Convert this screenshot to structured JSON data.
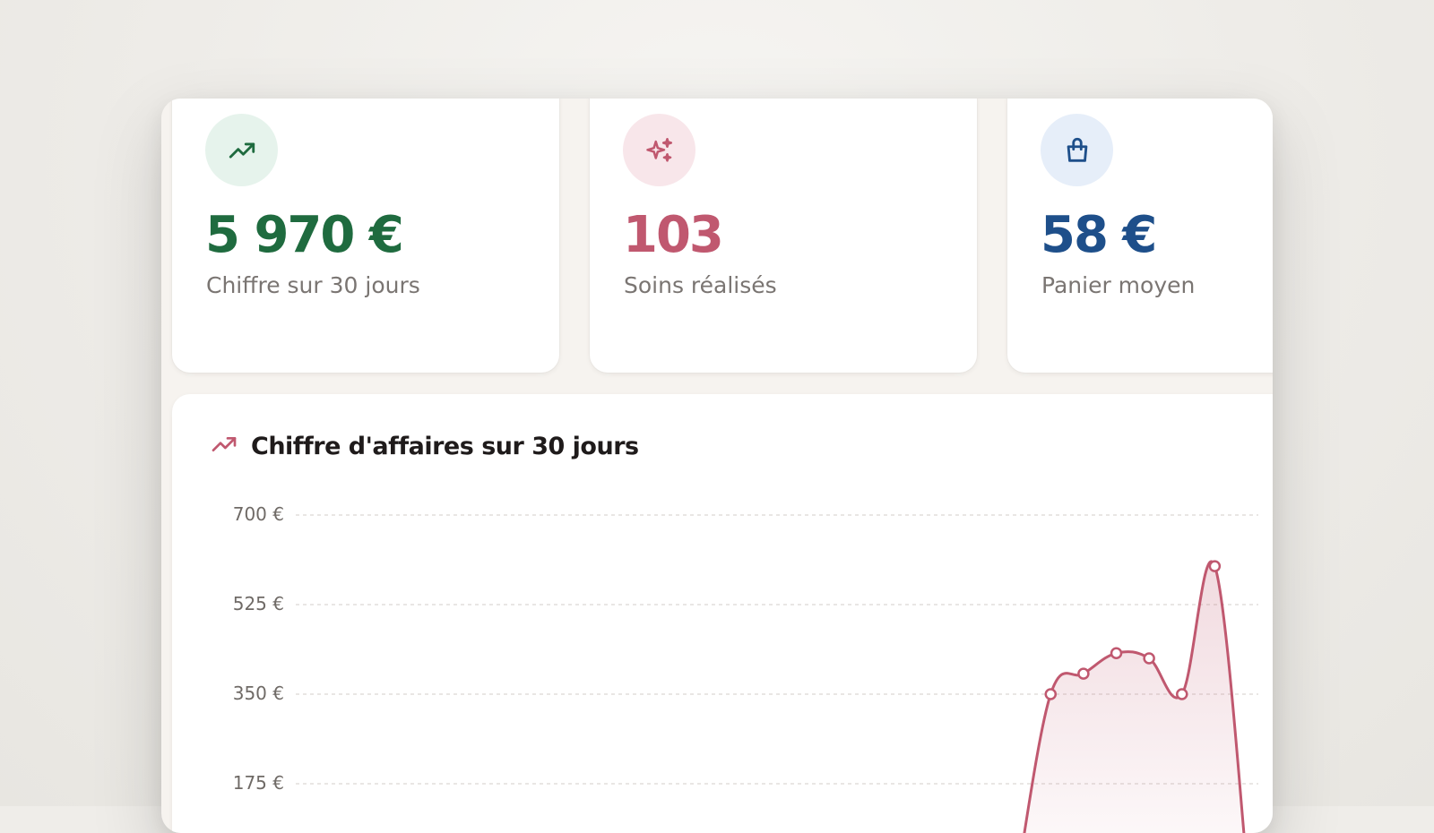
{
  "stats": [
    {
      "value": "5 970 €",
      "label": "Chiffre sur 30 jours",
      "icon": "trending-up-icon",
      "color": "#1f6b3f"
    },
    {
      "value": "103",
      "label": "Soins réalisés",
      "icon": "sparkles-icon",
      "color": "#c0586f"
    },
    {
      "value": "58 €",
      "label": "Panier moyen",
      "icon": "shopping-bag-icon",
      "color": "#1e4f8a"
    }
  ],
  "chart_card": {
    "title": "Chiffre d'affaires sur 30 jours",
    "icon": "trending-up-icon"
  },
  "chart_data": {
    "type": "area",
    "ylim": [
      0,
      700
    ],
    "yticks": [
      "700 €",
      "525 €",
      "350 €",
      "175 €"
    ],
    "ytick_values": [
      700,
      525,
      350,
      175
    ],
    "grid": true,
    "line_color": "#c0586f",
    "points": [
      {
        "x": 23,
        "y": 0
      },
      {
        "x": 24,
        "y": 350
      },
      {
        "x": 25,
        "y": 390
      },
      {
        "x": 26,
        "y": 430
      },
      {
        "x": 27,
        "y": 420
      },
      {
        "x": 28,
        "y": 350
      },
      {
        "x": 29,
        "y": 600
      },
      {
        "x": 30,
        "y": 0
      }
    ],
    "x_min": 1,
    "x_max": 30
  }
}
